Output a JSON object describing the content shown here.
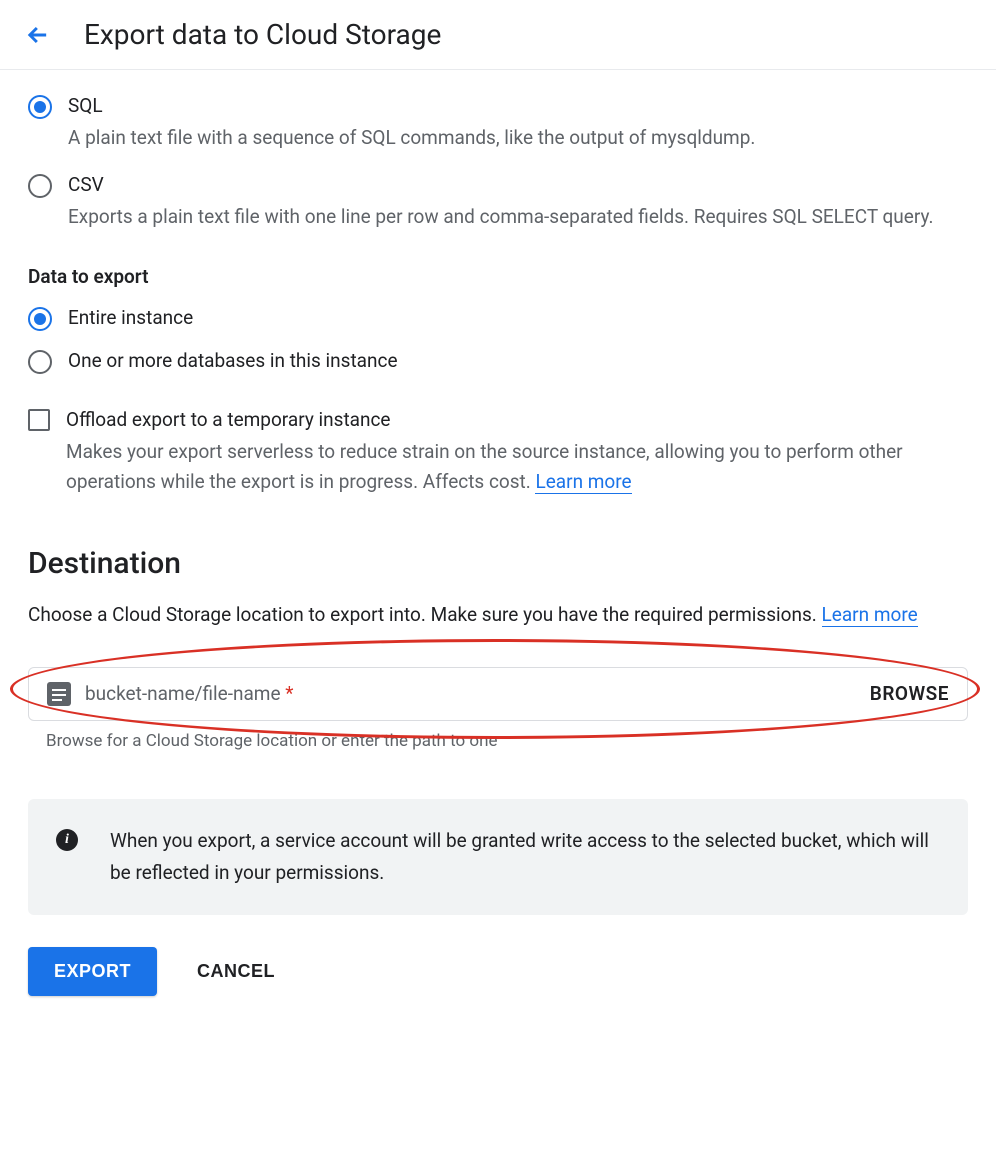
{
  "header": {
    "title": "Export data to Cloud Storage"
  },
  "format": {
    "sql": {
      "label": "SQL",
      "desc": "A plain text file with a sequence of SQL commands, like the output of mysqldump."
    },
    "csv": {
      "label": "CSV",
      "desc": "Exports a plain text file with one line per row and comma-separated fields. Requires SQL SELECT query."
    }
  },
  "dataScope": {
    "heading": "Data to export",
    "entire": "Entire instance",
    "subset": "One or more databases in this instance"
  },
  "offload": {
    "label": "Offload export to a temporary instance",
    "desc": "Makes your export serverless to reduce strain on the source instance, allowing you to perform other operations while the export is in progress. Affects cost. ",
    "learnMore": "Learn more"
  },
  "destination": {
    "heading": "Destination",
    "desc": "Choose a Cloud Storage location to export into. Make sure you have the required permissions. ",
    "learnMore": "Learn more",
    "placeholder": "bucket-name/file-name",
    "browse": "BROWSE",
    "helper": "Browse for a Cloud Storage location or enter the path to one"
  },
  "info": {
    "text": "When you export, a service account will be granted write access to the selected bucket, which will be reflected in your permissions."
  },
  "actions": {
    "export": "EXPORT",
    "cancel": "CANCEL"
  }
}
